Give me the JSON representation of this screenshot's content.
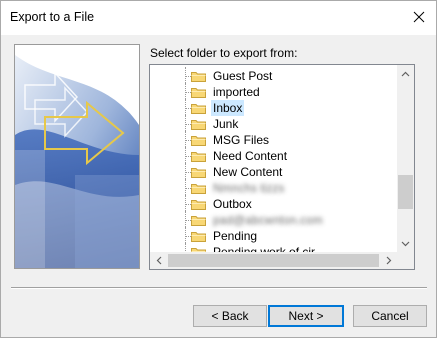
{
  "window": {
    "title": "Export to a File",
    "close_icon": "close-icon"
  },
  "prompt_label": "Select folder to export from:",
  "folders": [
    {
      "label": "Guest Post",
      "selected": false,
      "blurred": false
    },
    {
      "label": "imported",
      "selected": false,
      "blurred": false
    },
    {
      "label": "Inbox",
      "selected": true,
      "blurred": false
    },
    {
      "label": "Junk",
      "selected": false,
      "blurred": false
    },
    {
      "label": "MSG Files",
      "selected": false,
      "blurred": false
    },
    {
      "label": "Need Content",
      "selected": false,
      "blurred": false
    },
    {
      "label": "New Content",
      "selected": false,
      "blurred": false
    },
    {
      "label": "Nmnchs tizzs",
      "selected": false,
      "blurred": true
    },
    {
      "label": "Outbox",
      "selected": false,
      "blurred": false
    },
    {
      "label": "pad@abcwnton.com",
      "selected": false,
      "blurred": true
    },
    {
      "label": "Pending",
      "selected": false,
      "blurred": false
    },
    {
      "label": "Pending work of cir",
      "selected": false,
      "blurred": false
    }
  ],
  "buttons": {
    "back": "< Back",
    "next": "Next >",
    "cancel": "Cancel"
  },
  "colors": {
    "selection": "#cce8ff",
    "default_button_border": "#0078d7",
    "folder_fill": "#f8d775",
    "folder_edge": "#c9a23a"
  }
}
